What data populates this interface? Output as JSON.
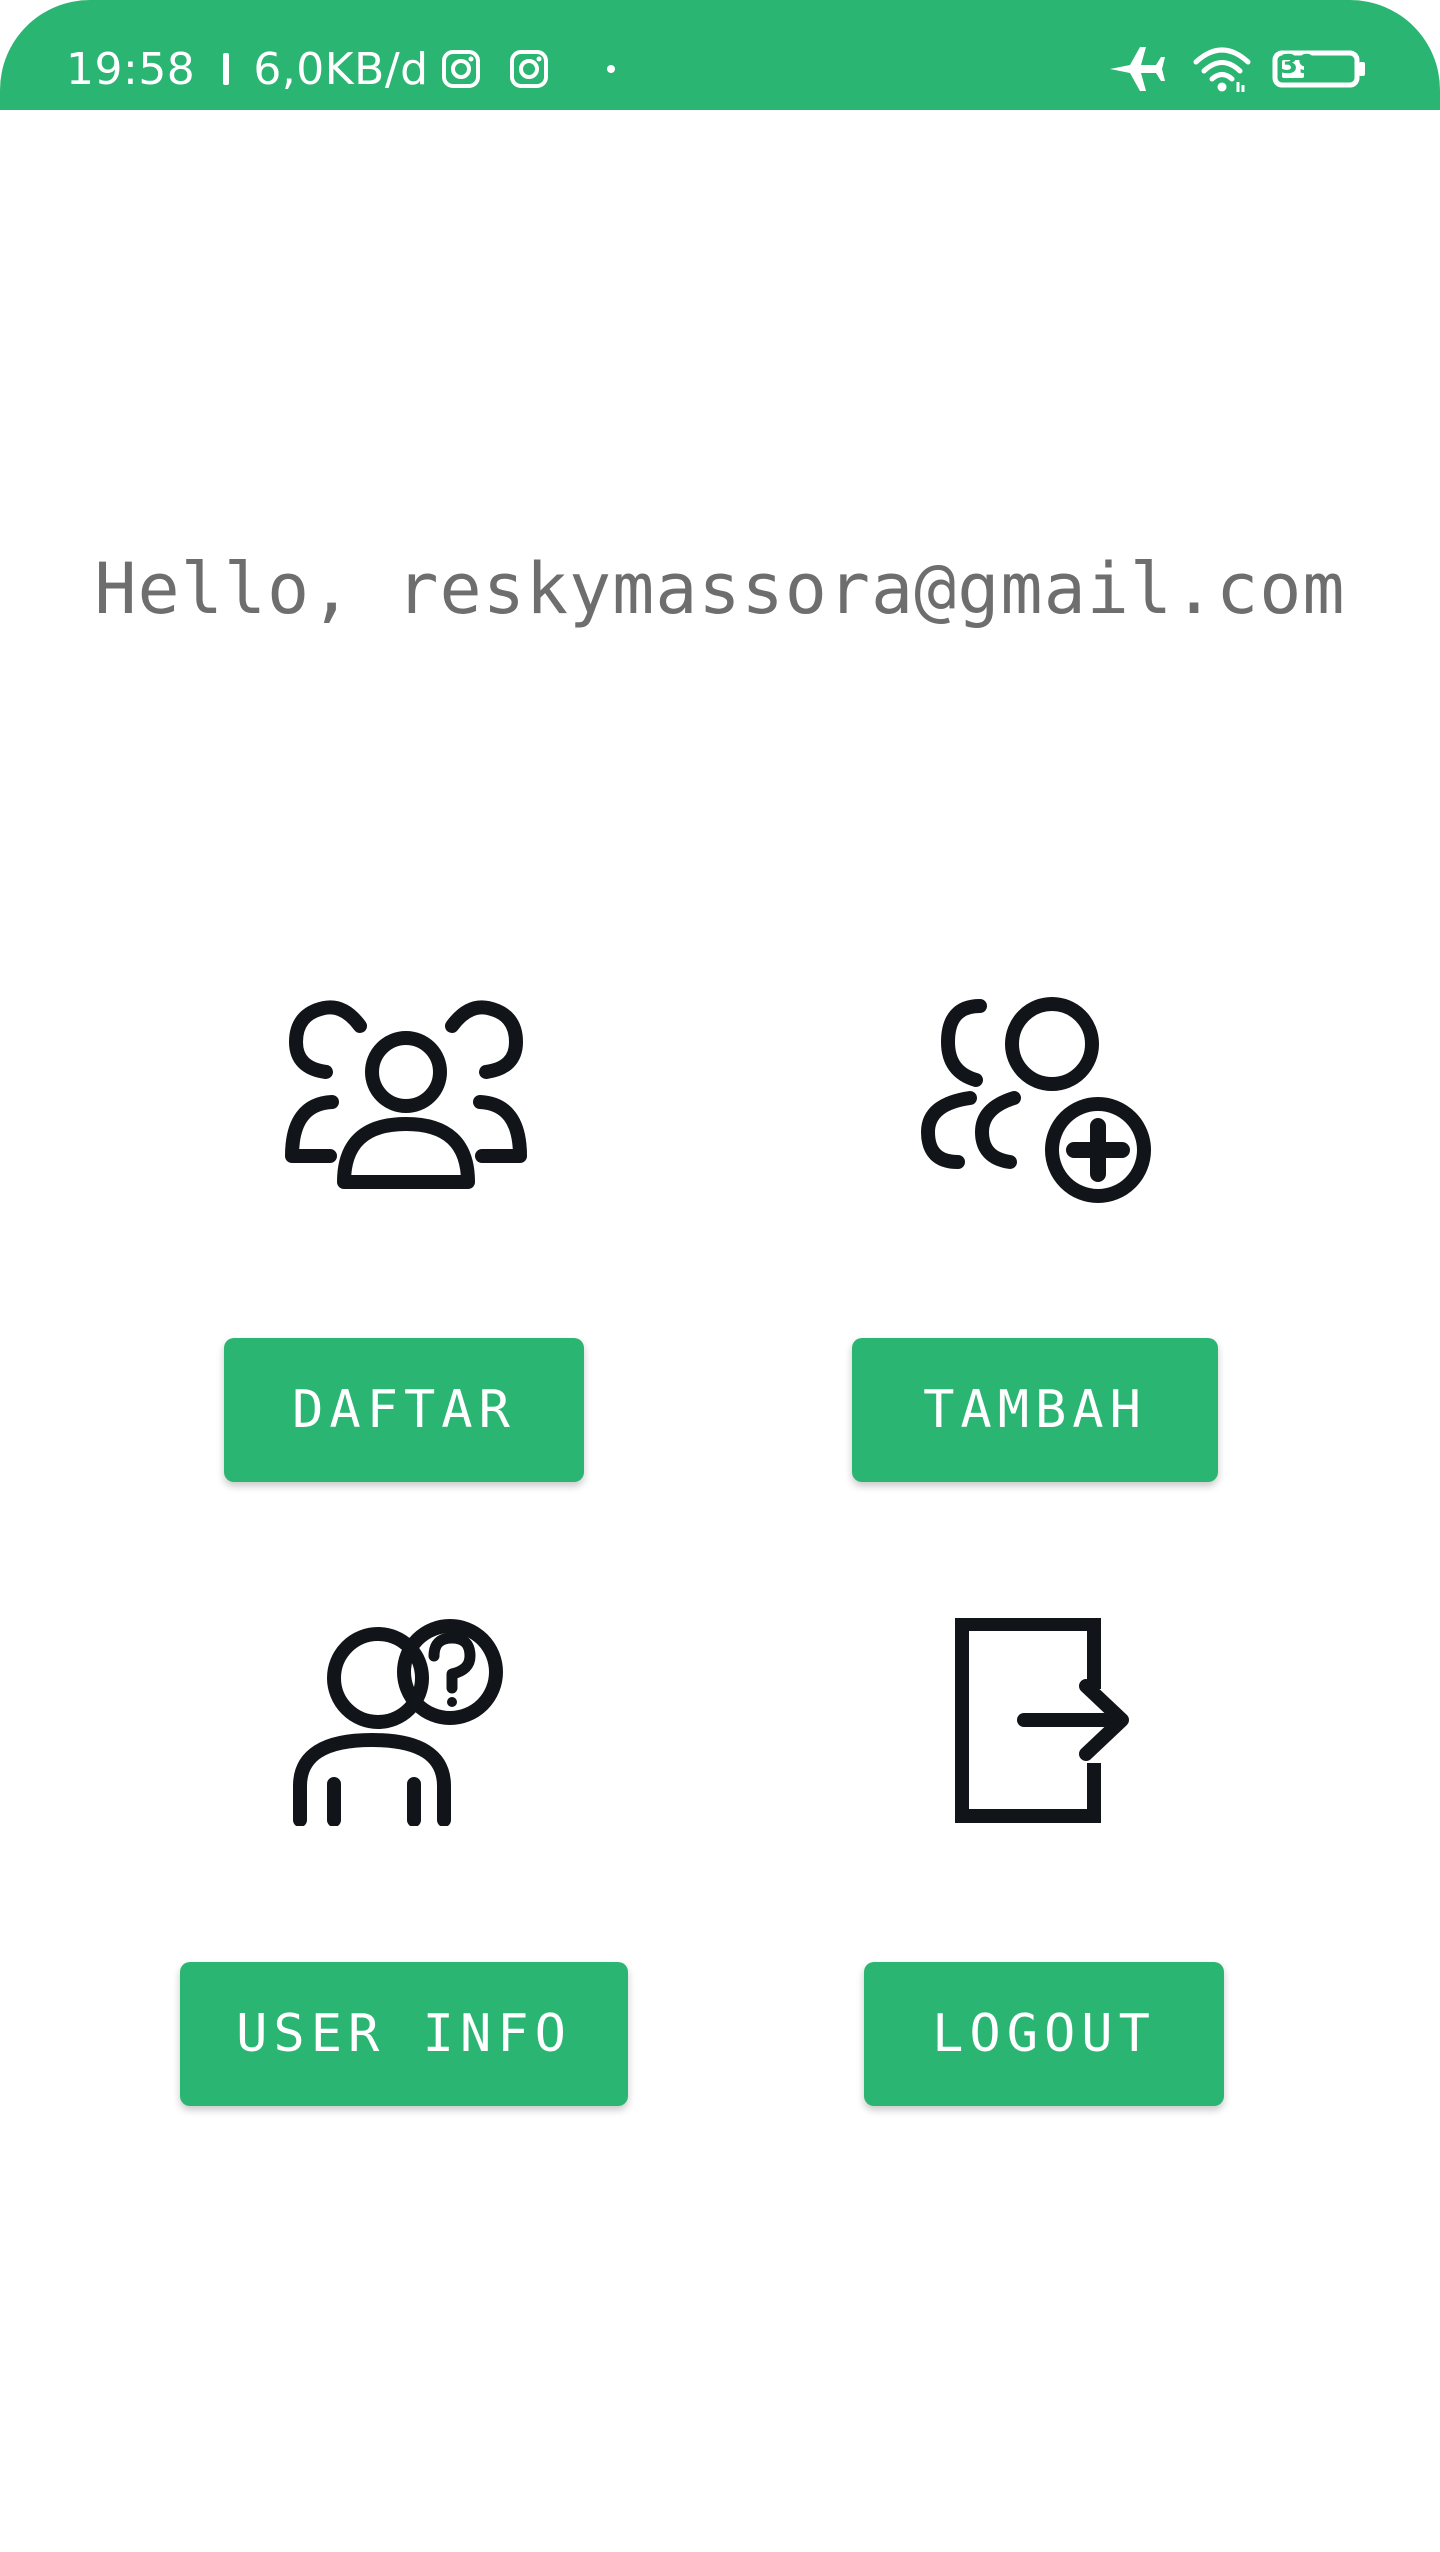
{
  "status_bar": {
    "time": "19:58",
    "network_speed": "6,0KB/d",
    "battery_level": "39",
    "icons": [
      "instagram-icon",
      "instagram-icon",
      "dot-icon",
      "airplane-icon",
      "wifi-icon",
      "battery-icon"
    ],
    "color": "#2bb573"
  },
  "greeting": {
    "text": "Hello, reskymassora@gmail.com"
  },
  "menu": {
    "daftar": {
      "label": "DAFTAR",
      "icon": "group-users-icon"
    },
    "tambah": {
      "label": "TAMBAH",
      "icon": "add-user-icon"
    },
    "user_info": {
      "label": "USER INFO",
      "icon": "user-question-icon"
    },
    "logout": {
      "label": "LOGOUT",
      "icon": "logout-icon"
    }
  },
  "colors": {
    "accent": "#2bb573",
    "greeting_text": "#6e6e6e",
    "icon_stroke": "#111418"
  }
}
